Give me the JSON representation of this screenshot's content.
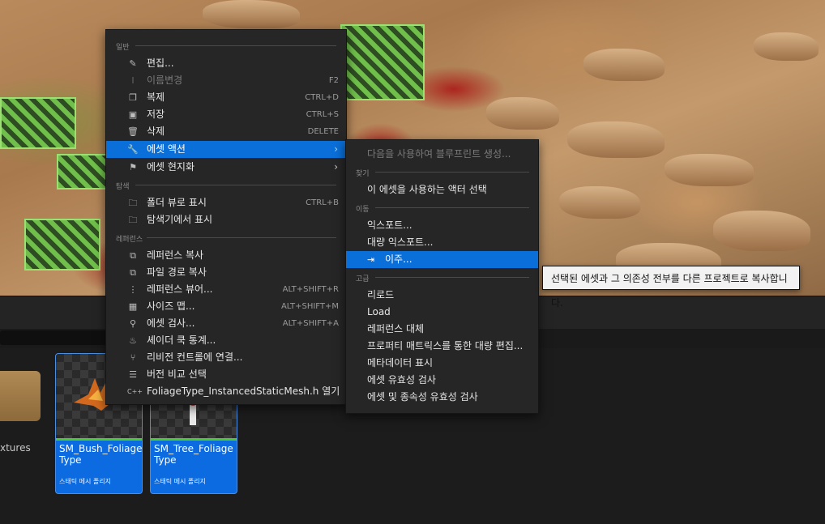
{
  "main_menu": {
    "sections": {
      "general": "일반",
      "explore": "탐색",
      "references": "레퍼런스"
    },
    "items": [
      {
        "label": "편집...",
        "shortcut": "",
        "icon": "pencil-icon"
      },
      {
        "label": "이름변경",
        "shortcut": "F2",
        "icon": "rename-icon"
      },
      {
        "label": "복제",
        "shortcut": "CTRL+D",
        "icon": "duplicate-icon"
      },
      {
        "label": "저장",
        "shortcut": "CTRL+S",
        "icon": "save-icon"
      },
      {
        "label": "삭제",
        "shortcut": "DELETE",
        "icon": "trash-icon"
      },
      {
        "label": "에셋 액션",
        "shortcut": "",
        "icon": "wrench-icon"
      },
      {
        "label": "에셋 현지화",
        "shortcut": "",
        "icon": "flag-icon"
      },
      {
        "label": "폴더 뷰로 표시",
        "shortcut": "CTRL+B",
        "icon": "folder-search-icon"
      },
      {
        "label": "탐색기에서 표시",
        "shortcut": "",
        "icon": "explorer-icon"
      },
      {
        "label": "레퍼런스 복사",
        "shortcut": "",
        "icon": "copy-reference-icon"
      },
      {
        "label": "파일 경로 복사",
        "shortcut": "",
        "icon": "copy-path-icon"
      },
      {
        "label": "레퍼런스 뷰어...",
        "shortcut": "ALT+SHIFT+R",
        "icon": "reference-viewer-icon"
      },
      {
        "label": "사이즈 맵...",
        "shortcut": "ALT+SHIFT+M",
        "icon": "size-map-icon"
      },
      {
        "label": "에셋 검사...",
        "shortcut": "ALT+SHIFT+A",
        "icon": "audit-icon"
      },
      {
        "label": "셰이더 쿡 통계...",
        "shortcut": "",
        "icon": "shader-stats-icon"
      },
      {
        "label": "리비전 컨트롤에 연결...",
        "shortcut": "",
        "icon": "revision-control-icon"
      },
      {
        "label": "버전 비교 선택",
        "shortcut": "",
        "icon": "diff-icon"
      },
      {
        "label": "FoliageType_InstancedStaticMesh.h 열기",
        "shortcut": "",
        "icon": "cpp-file-icon"
      }
    ]
  },
  "sub_menu": {
    "sections": {
      "find": "찾기",
      "move": "이동",
      "advanced": "고급"
    },
    "items": [
      {
        "label": "다음을 사용하여 블루프린트 생성..."
      },
      {
        "label": "이 에셋을 사용하는 액터 선택"
      },
      {
        "label": "익스포트..."
      },
      {
        "label": "대량 익스포트..."
      },
      {
        "label": "이주...",
        "icon": "migrate-icon"
      },
      {
        "label": "리로드"
      },
      {
        "label": "Load"
      },
      {
        "label": "레퍼런스 대체"
      },
      {
        "label": "프로퍼티 매트릭스를 통한 대량 편집..."
      },
      {
        "label": "메타데이터 표시"
      },
      {
        "label": "에셋 유효성 검사"
      },
      {
        "label": "에셋 및 종속성 유효성 검사"
      }
    ]
  },
  "tooltip": "선택된 에셋과 그 의존성 전부를 다른 프로젝트로 복사합니다.",
  "content_browser": {
    "folder_label": "xtures",
    "assets": [
      {
        "name": "SM_Bush_Foliage Type",
        "type": "스태틱 메시 폴리지"
      },
      {
        "name": "SM_Tree_Foliage Type",
        "type": "스태틱 메시 폴리지"
      }
    ]
  },
  "colors": {
    "menu_bg": "#262626",
    "highlight": "#0a6fd8",
    "asset_tile": "#0c6be0",
    "tooltip_bg": "#f2f2f2"
  }
}
